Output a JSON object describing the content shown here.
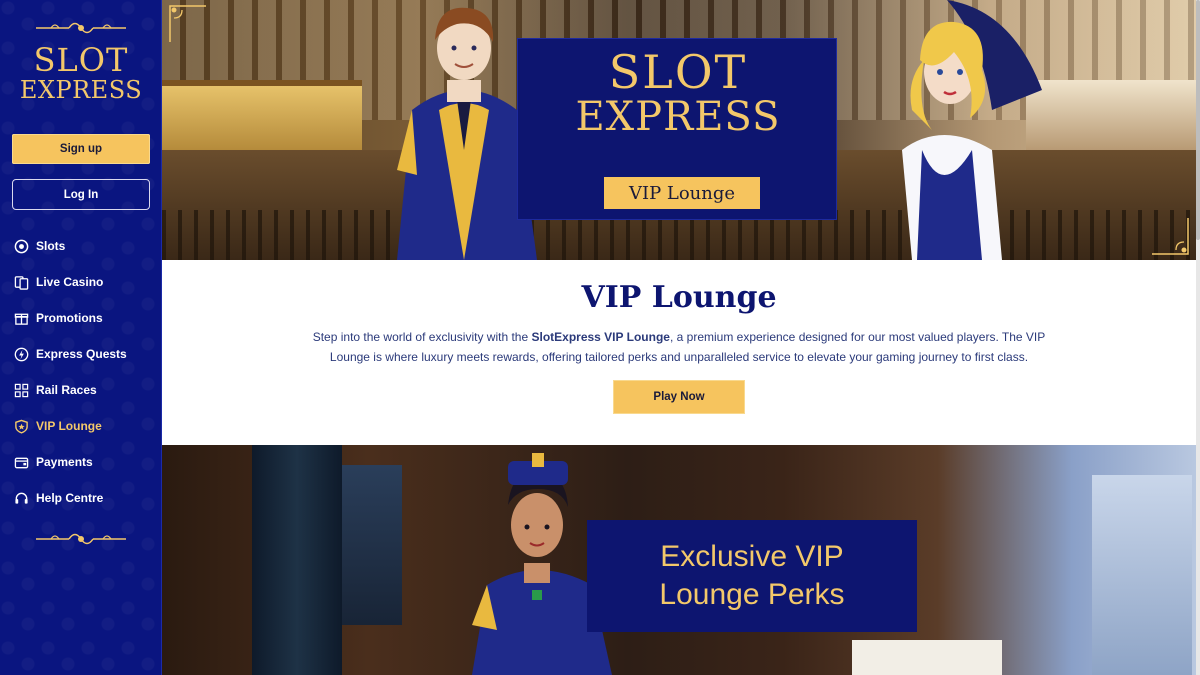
{
  "sidebar": {
    "logo": {
      "line1": "SLOT",
      "line2": "EXPRESS"
    },
    "signup_label": "Sign up",
    "login_label": "Log In",
    "items": [
      {
        "label": "Slots",
        "icon": "slot-reel-icon"
      },
      {
        "label": "Live Casino",
        "icon": "cards-icon"
      },
      {
        "label": "Promotions",
        "icon": "gift-icon"
      },
      {
        "label": "Express Quests",
        "icon": "lightning-icon"
      },
      {
        "label": "Rail Races",
        "icon": "grid-icon"
      },
      {
        "label": "VIP Lounge",
        "icon": "shield-icon",
        "active": true
      },
      {
        "label": "Payments",
        "icon": "wallet-icon"
      },
      {
        "label": "Help Centre",
        "icon": "headset-icon"
      }
    ]
  },
  "hero": {
    "logo": {
      "line1": "SLOT",
      "line2": "EXPRESS"
    },
    "tag": "VIP Lounge"
  },
  "content": {
    "title": "VIP Lounge",
    "text_before": "Step into the world of exclusivity with the ",
    "text_bold": "SlotExpress VIP Lounge",
    "text_after": ", a premium experience designed for our most valued players. The VIP Lounge is where luxury meets rewards, offering tailored perks and unparalleled service to elevate your gaming journey to first class.",
    "play_label": "Play Now"
  },
  "promo": {
    "title_line1": "Exclusive VIP",
    "title_line2": "Lounge Perks"
  },
  "colors": {
    "sidebar_bg": "#0a1580",
    "gold": "#f3c86a",
    "button_gold": "#f6c45e",
    "navy": "#0d1570"
  }
}
